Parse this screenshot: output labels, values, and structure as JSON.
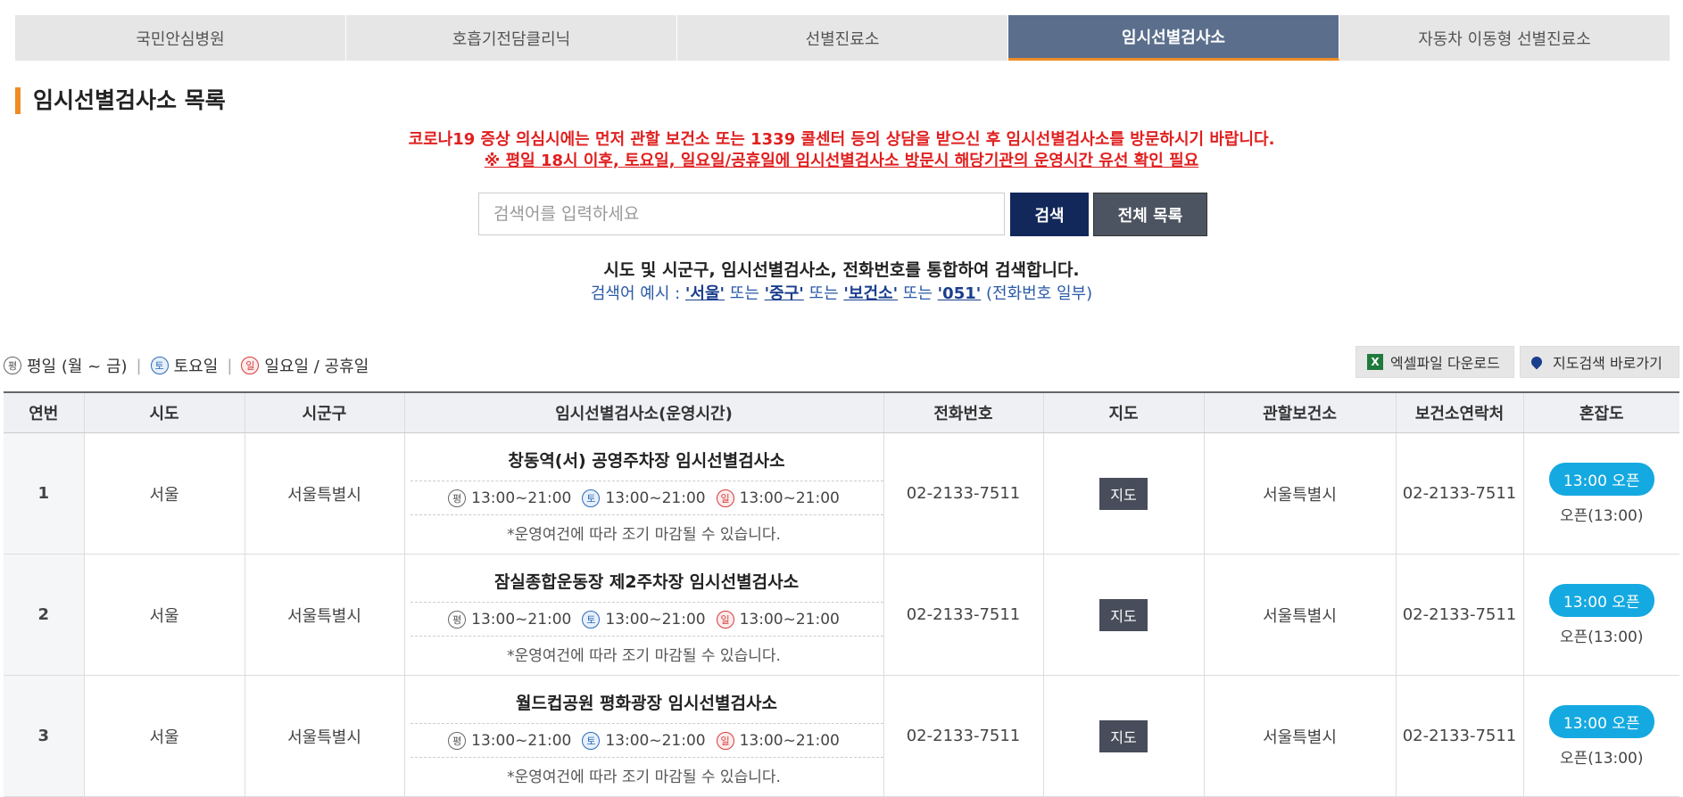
{
  "tabs": [
    "국민안심병원",
    "호흡기전담클리닉",
    "선별진료소",
    "임시선별검사소",
    "자동차 이동형 선별진료소"
  ],
  "active_tab_index": 3,
  "section_title": "임시선별검사소 목록",
  "notice": {
    "line1": "코로나19 증상 의심시에는 먼저 관할 보건소 또는 1339 콜센터 등의 상담을 받으신 후 임시선별검사소를 방문하시기 바랍니다.",
    "line2": "※ 평일 18시 이후, 토요일, 일요일/공휴일에 임시선별검사소 방문시 해당기관의 운영시간 유선 확인 필요"
  },
  "search": {
    "placeholder": "검색어를 입력하세요",
    "search_label": "검색",
    "all_label": "전체 목록"
  },
  "help": {
    "line1": "시도 및 시군구, 임시선별검사소, 전화번호를 통합하여 검색합니다.",
    "prefix": "검색어 예시 : ",
    "ex1": "'서울'",
    "or1": " 또는 ",
    "ex2": "'중구'",
    "or2": " 또는 ",
    "ex3": "'보건소'",
    "or3": " 또는 ",
    "ex4": "'051'",
    "suffix": " (전화번호 일부)"
  },
  "legend": {
    "weekday_badge": "평",
    "weekday_label": "평일 (월 ~ 금)",
    "sat_badge": "토",
    "sat_label": "토요일",
    "sun_badge": "일",
    "sun_label": "일요일 / 공휴일",
    "sep": "|"
  },
  "tools": {
    "excel_label": "엑셀파일 다운로드",
    "excel_icon": "X",
    "map_label": "지도검색 바로가기"
  },
  "table": {
    "headers": [
      "연번",
      "시도",
      "시군구",
      "임시선별검사소(운영시간)",
      "전화번호",
      "지도",
      "관할보건소",
      "보건소연락처",
      "혼잡도"
    ],
    "rows": [
      {
        "no": "1",
        "sido": "서울",
        "sigungu": "서울특별시",
        "name": "창동역(서) 공영주차장 임시선별검사소",
        "weekday": "13:00~21:00",
        "sat": "13:00~21:00",
        "sun": "13:00~21:00",
        "note": "*운영여건에 따라 조기 마감될 수 있습니다.",
        "phone": "02-2133-7511",
        "map": "지도",
        "health_center": "서울특별시",
        "hc_phone": "02-2133-7511",
        "status_pill": "13:00 오픈",
        "status_text": "오픈(13:00)"
      },
      {
        "no": "2",
        "sido": "서울",
        "sigungu": "서울특별시",
        "name": "잠실종합운동장 제2주차장 임시선별검사소",
        "weekday": "13:00~21:00",
        "sat": "13:00~21:00",
        "sun": "13:00~21:00",
        "note": "*운영여건에 따라 조기 마감될 수 있습니다.",
        "phone": "02-2133-7511",
        "map": "지도",
        "health_center": "서울특별시",
        "hc_phone": "02-2133-7511",
        "status_pill": "13:00 오픈",
        "status_text": "오픈(13:00)"
      },
      {
        "no": "3",
        "sido": "서울",
        "sigungu": "서울특별시",
        "name": "월드컵공원 평화광장 임시선별검사소",
        "weekday": "13:00~21:00",
        "sat": "13:00~21:00",
        "sun": "13:00~21:00",
        "note": "*운영여건에 따라 조기 마감될 수 있습니다.",
        "phone": "02-2133-7511",
        "map": "지도",
        "health_center": "서울특별시",
        "hc_phone": "02-2133-7511",
        "status_pill": "13:00 오픈",
        "status_text": "오픈(13:00)"
      }
    ]
  },
  "colors": {
    "accent_orange": "#f08c24",
    "tab_active": "#5b6f8d",
    "notice_red": "#e02020",
    "open_blue": "#14a9e0"
  }
}
